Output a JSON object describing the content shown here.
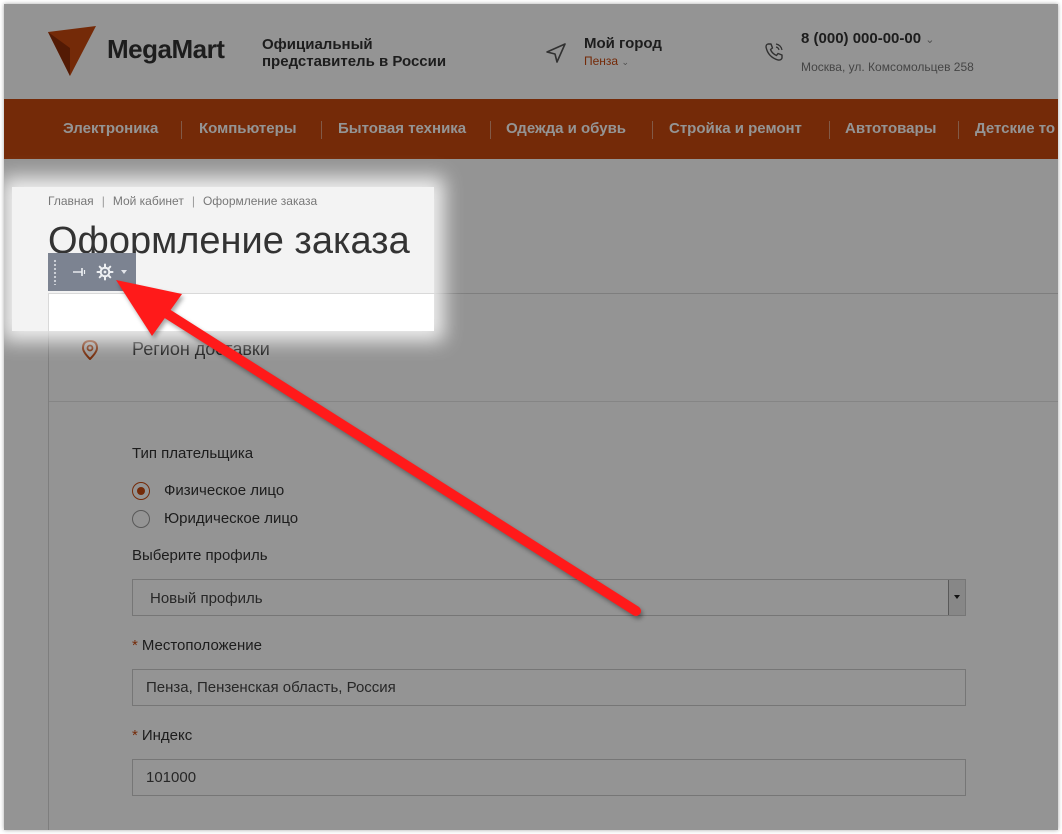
{
  "brand": {
    "name": "MegaMart",
    "tagline": "Официальный представитель в России",
    "accent": "#c9490f"
  },
  "city": {
    "title": "Мой город",
    "current": "Пенза"
  },
  "contacts": {
    "phone": "8 (000) 000-00-00",
    "address": "Москва, ул. Комсомольцев 258"
  },
  "nav": {
    "items": [
      "Электроника",
      "Компьютеры",
      "Бытовая техника",
      "Одежда и обувь",
      "Стройка и ремонт",
      "Автотовары",
      "Детские то"
    ]
  },
  "breadcrumb": [
    "Главная",
    "Мой кабинет",
    "Оформление заказа"
  ],
  "page_title": "Оформление заказа",
  "order": {
    "region_title": "Регион доставки",
    "payer_type_label": "Тип плательщика",
    "payer_types": [
      {
        "label": "Физическое лицо",
        "checked": true
      },
      {
        "label": "Юридическое лицо",
        "checked": false
      }
    ],
    "profile_label": "Выберите профиль",
    "profile_value": "Новый профиль",
    "location_label": "Местоположение",
    "location_value": "Пенза, Пензенская область, Россия",
    "index_label": "Индекс",
    "index_value": "101000",
    "required_mark": "*"
  },
  "toolbar": {
    "icons": [
      "grip-icon",
      "pin-icon",
      "gear-icon",
      "caret-down-icon"
    ]
  },
  "annotation": {
    "arrow_color": "#ff1a1a"
  }
}
